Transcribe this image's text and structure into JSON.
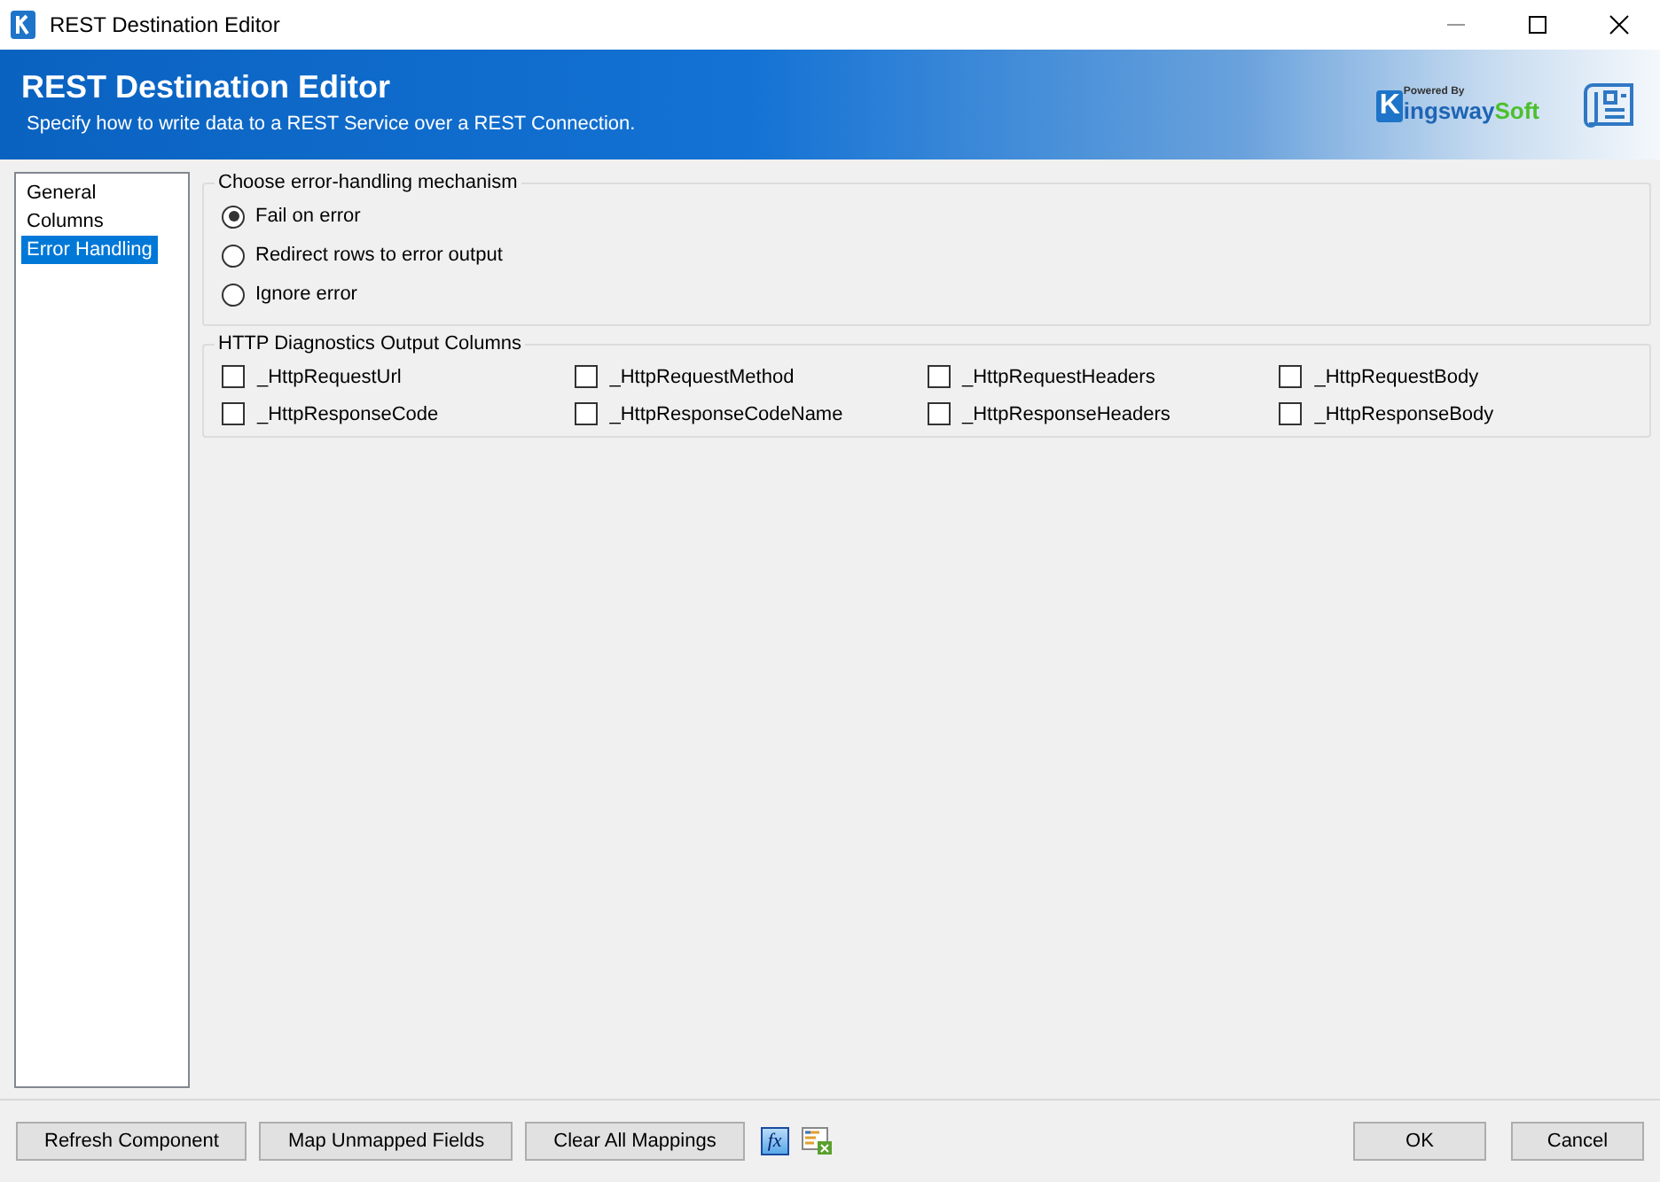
{
  "window": {
    "title": "REST Destination Editor"
  },
  "banner": {
    "title": "REST Destination Editor",
    "subtitle": "Specify how to write data to a REST Service over a REST Connection.",
    "logo": {
      "powered_by": "Powered By",
      "mark": "K",
      "name_1": "ingsway",
      "name_2": "Soft"
    }
  },
  "sidebar": {
    "items": [
      {
        "label": "General",
        "selected": false
      },
      {
        "label": "Columns",
        "selected": false
      },
      {
        "label": "Error Handling",
        "selected": true
      }
    ]
  },
  "error_group": {
    "title": "Choose error-handling mechanism",
    "options": [
      {
        "label": "Fail on error",
        "selected": true
      },
      {
        "label": "Redirect rows to error output",
        "selected": false
      },
      {
        "label": "Ignore error",
        "selected": false
      }
    ]
  },
  "diagnostics_group": {
    "title": "HTTP Diagnostics Output Columns",
    "columns": [
      {
        "label": "_HttpRequestUrl",
        "checked": false
      },
      {
        "label": "_HttpRequestMethod",
        "checked": false
      },
      {
        "label": "_HttpRequestHeaders",
        "checked": false
      },
      {
        "label": "_HttpRequestBody",
        "checked": false
      },
      {
        "label": "_HttpResponseCode",
        "checked": false
      },
      {
        "label": "_HttpResponseCodeName",
        "checked": false
      },
      {
        "label": "_HttpResponseHeaders",
        "checked": false
      },
      {
        "label": "_HttpResponseBody",
        "checked": false
      }
    ]
  },
  "footer": {
    "left_buttons": [
      "Refresh Component",
      "Map Unmapped Fields",
      "Clear All Mappings"
    ],
    "fx_icon_text": "fx",
    "right_buttons": [
      "OK",
      "Cancel"
    ]
  }
}
